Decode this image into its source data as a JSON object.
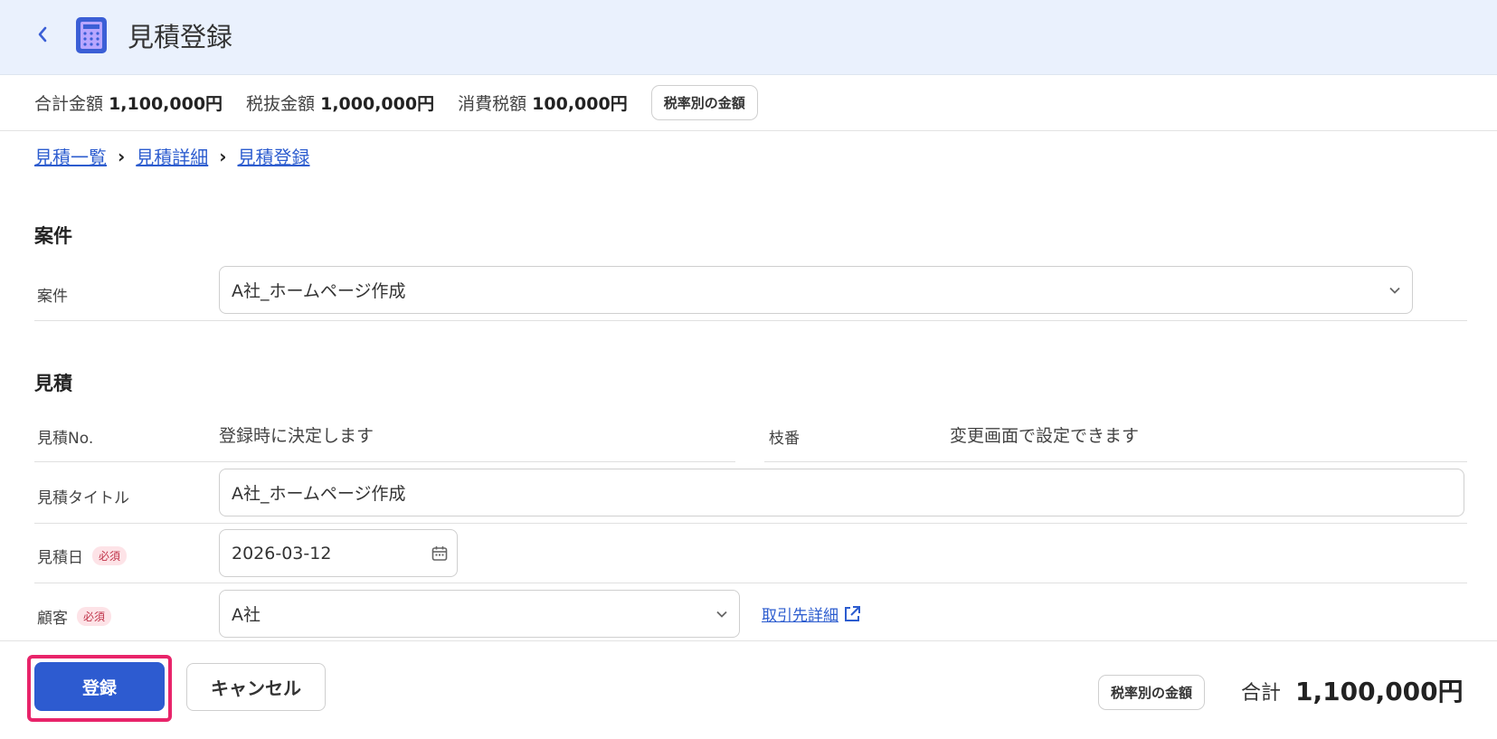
{
  "header": {
    "title": "見積登録",
    "back_icon": "chevron-left-icon",
    "app_icon": "calculator-icon"
  },
  "summary": {
    "total_label": "合計金額",
    "total_value": "1,100,000円",
    "pretax_label": "税抜金額",
    "pretax_value": "1,000,000円",
    "tax_label": "消費税額",
    "tax_value": "100,000円",
    "tax_rate_button": "税率別の金額"
  },
  "breadcrumb": [
    "見積一覧",
    "見積詳細",
    "見積登録"
  ],
  "sections": {
    "project": {
      "title": "案件",
      "project_label": "案件",
      "project_value": "A社_ホームページ作成"
    },
    "estimate": {
      "title": "見積",
      "number_label": "見積No.",
      "number_value": "登録時に決定します",
      "branch_label": "枝番",
      "branch_value": "変更画面で設定できます",
      "title_label": "見積タイトル",
      "title_value": "A社_ホームページ作成",
      "date_label": "見積日",
      "date_value": "2026-03-12",
      "customer_label": "顧客",
      "customer_value": "A社",
      "required_badge": "必須",
      "partner_detail_link": "取引先詳細"
    }
  },
  "footer": {
    "register_button": "登録",
    "cancel_button": "キャンセル",
    "tax_rate_button": "税率別の金額",
    "total_label": "合計",
    "total_value": "1,100,000円"
  },
  "colors": {
    "accent": "#2d5bd0",
    "highlight": "#e8246a",
    "header_bg": "#eaf1fd",
    "required": "#c0344a"
  }
}
